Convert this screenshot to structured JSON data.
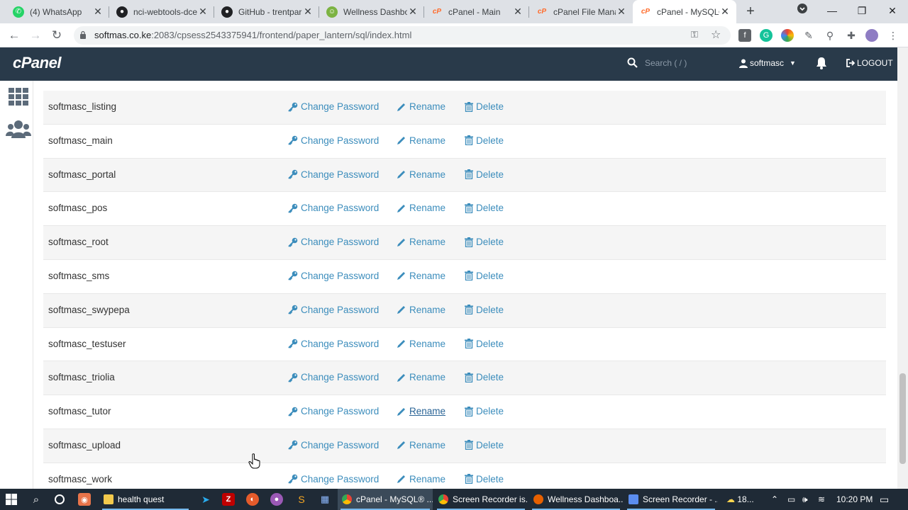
{
  "browser": {
    "tabs": [
      {
        "title": "(4) WhatsApp",
        "favicon": "whatsapp-icon",
        "color": "#25d366"
      },
      {
        "title": "nci-webtools-dce",
        "favicon": "github-icon",
        "color": "#202124"
      },
      {
        "title": "GitHub - trentpar",
        "favicon": "github-icon",
        "color": "#202124"
      },
      {
        "title": "Wellness Dashbo",
        "favicon": "wellness-icon",
        "color": "#7cb342"
      },
      {
        "title": "cPanel - Main",
        "favicon": "cpanel-icon",
        "color": "#ff6c2c"
      },
      {
        "title": "cPanel File Manag",
        "favicon": "cpanel-icon",
        "color": "#ff6c2c"
      },
      {
        "title": "cPanel - MySQL®",
        "favicon": "cpanel-icon",
        "color": "#ff6c2c",
        "active": true
      }
    ],
    "url_host": "softmas.co.ke",
    "url_rest": ":2083/cpsess2543375941/frontend/paper_lantern/sql/index.html"
  },
  "cpanel": {
    "logo": "cPanel",
    "search_placeholder": "Search ( / )",
    "username": "softmasc",
    "logout": "LOGOUT"
  },
  "actions": {
    "change_password": "Change Password",
    "rename": "Rename",
    "delete": "Delete"
  },
  "users": [
    "softmasc_listing",
    "softmasc_main",
    "softmasc_portal",
    "softmasc_pos",
    "softmasc_root",
    "softmasc_sms",
    "softmasc_swypepa",
    "softmasc_testuser",
    "softmasc_triolia",
    "softmasc_tutor",
    "softmasc_upload",
    "softmasc_work"
  ],
  "hovered_rename_row": 9,
  "taskbar": {
    "apps": [
      {
        "title": "health quest",
        "color": "#f2c94c"
      },
      {
        "title": "cPanel - MySQL® ...",
        "color": "#4285f4",
        "active": true
      },
      {
        "title": "Screen Recorder is...",
        "color": "#4285f4"
      },
      {
        "title": "Wellness Dashboa...",
        "color": "#e66000"
      },
      {
        "title": "Screen Recorder - ...",
        "color": "#5b8def"
      }
    ],
    "weather": "18...",
    "time": "10:20 PM"
  },
  "colors": {
    "link": "#3c8dbc",
    "header": "#293a4a"
  }
}
